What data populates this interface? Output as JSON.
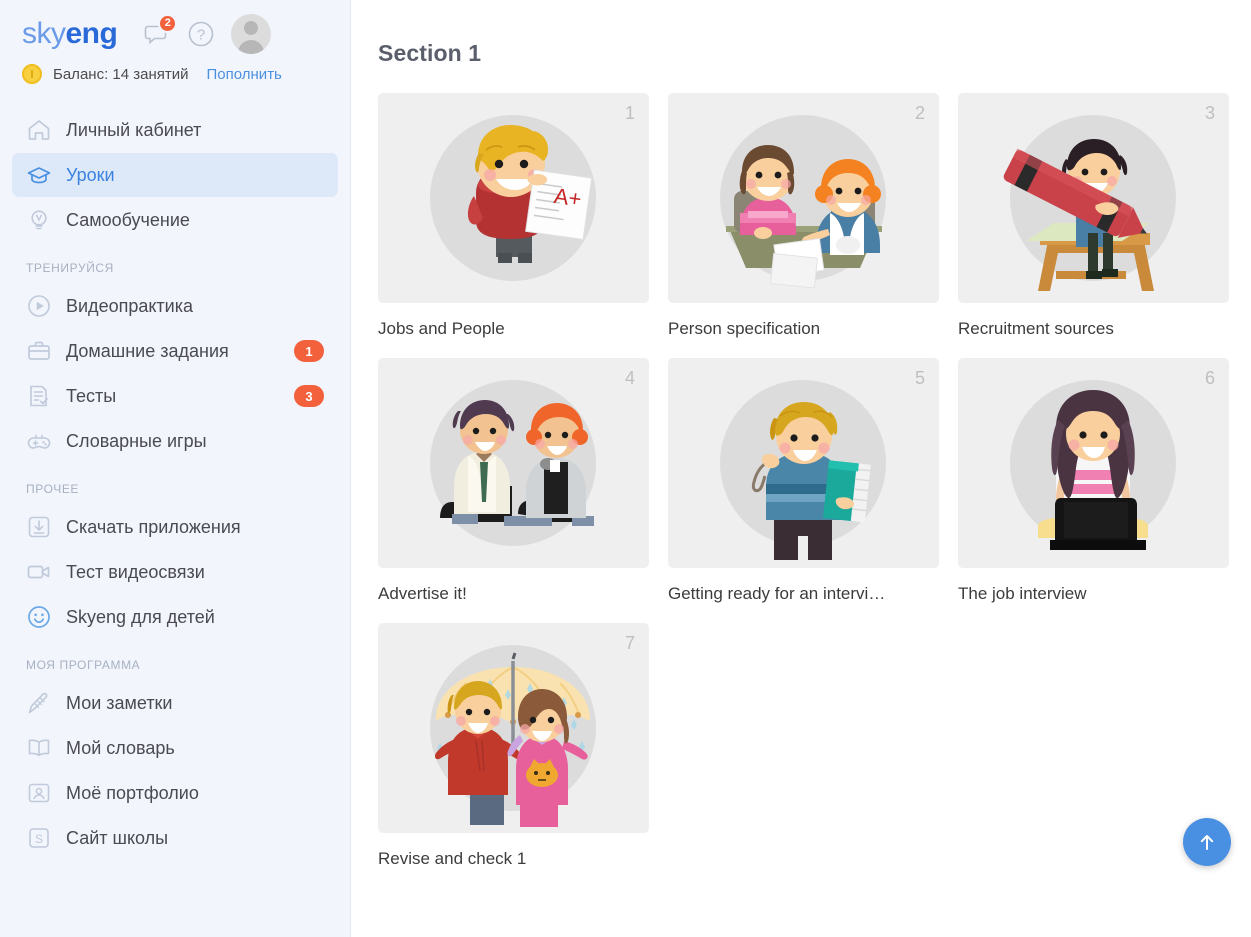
{
  "brand": {
    "part1": "sky",
    "part2": "eng"
  },
  "header": {
    "messages_badge": "2",
    "help_icon_glyph": "?",
    "icons": [
      "chat-icon",
      "help-icon",
      "avatar"
    ]
  },
  "balance": {
    "label": "Баланс: 14 занятий",
    "topup_label": "Пополнить",
    "coin_icon": "coin-icon"
  },
  "sidebar": {
    "groups": [
      {
        "title": null,
        "items": [
          {
            "label": "Личный кабинет",
            "icon": "home-icon",
            "badge": null,
            "active": false
          },
          {
            "label": "Уроки",
            "icon": "graduation-cap-icon",
            "badge": null,
            "active": true
          },
          {
            "label": "Самообучение",
            "icon": "lightbulb-icon",
            "badge": null,
            "active": false
          }
        ]
      },
      {
        "title": "ТРЕНИРУЙСЯ",
        "items": [
          {
            "label": "Видеопрактика",
            "icon": "play-circle-icon",
            "badge": null,
            "active": false
          },
          {
            "label": "Домашние задания",
            "icon": "briefcase-icon",
            "badge": "1",
            "active": false
          },
          {
            "label": "Тесты",
            "icon": "checklist-icon",
            "badge": "3",
            "active": false
          },
          {
            "label": "Словарные игры",
            "icon": "gamepad-icon",
            "badge": null,
            "active": false
          }
        ]
      },
      {
        "title": "ПРОЧЕЕ",
        "items": [
          {
            "label": "Скачать приложения",
            "icon": "download-icon",
            "badge": null,
            "active": false
          },
          {
            "label": "Тест видеосвязи",
            "icon": "video-camera-icon",
            "badge": null,
            "active": false
          },
          {
            "label": "Skyeng для детей",
            "icon": "smiley-face-icon",
            "badge": null,
            "active": false
          }
        ]
      },
      {
        "title": "МОЯ ПРОГРАММА",
        "items": [
          {
            "label": "Мои заметки",
            "icon": "pencil-icon",
            "badge": null,
            "active": false
          },
          {
            "label": "Мой словарь",
            "icon": "open-book-icon",
            "badge": null,
            "active": false
          },
          {
            "label": "Моё портфолио",
            "icon": "portfolio-icon",
            "badge": null,
            "active": false
          },
          {
            "label": "Сайт школы",
            "icon": "skyeng-site-icon",
            "badge": null,
            "active": false
          }
        ]
      }
    ]
  },
  "main": {
    "section_title": "Section 1",
    "cards": [
      {
        "number": "1",
        "title": "Jobs and People",
        "illustration": "boy-with-a-plus-test"
      },
      {
        "number": "2",
        "title": "Person specification",
        "illustration": "two-women-at-desk-interview"
      },
      {
        "number": "3",
        "title": "Recruitment sources",
        "illustration": "boy-drawing-with-big-pencil"
      },
      {
        "number": "4",
        "title": "Advertise it!",
        "illustration": "two-boys-sitting"
      },
      {
        "number": "5",
        "title": "Getting ready for an intervi…",
        "illustration": "boy-holding-books"
      },
      {
        "number": "6",
        "title": "The job interview",
        "illustration": "girl-with-laptop"
      },
      {
        "number": "7",
        "title": "Revise and check 1",
        "illustration": "two-kids-under-umbrella"
      }
    ],
    "scroll_top_icon": "arrow-up-icon"
  },
  "colors": {
    "brand_blue": "#2a6ad8",
    "accent_blue": "#4a90e2",
    "badge_red": "#f2603c",
    "sidebar_bg": "#f2f5fb",
    "active_item_bg": "#dde9f8",
    "card_bg": "#efefef",
    "thumb_circle": "#dcdcdc"
  }
}
